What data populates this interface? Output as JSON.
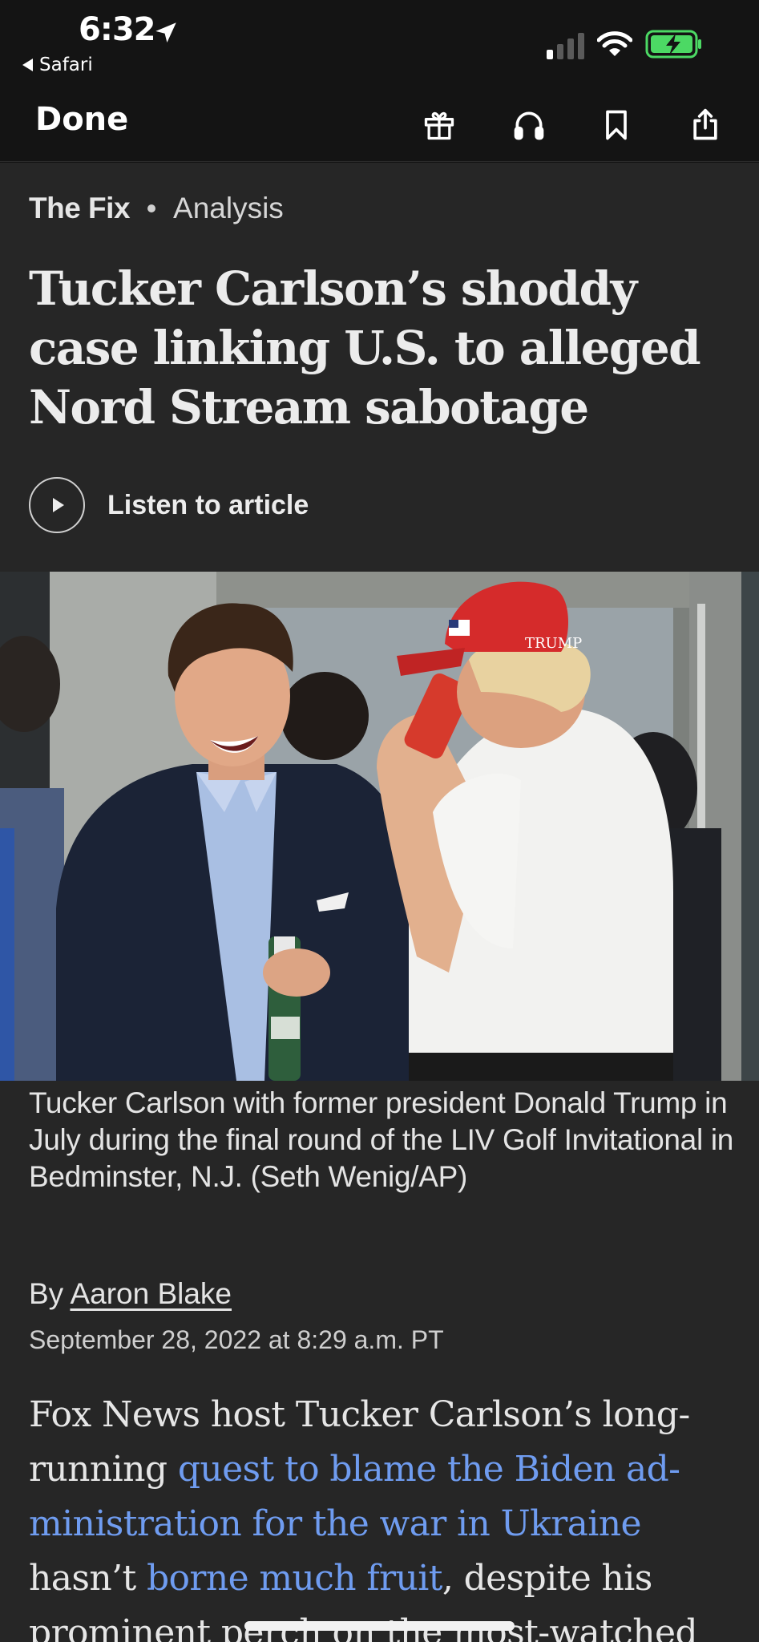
{
  "status_bar": {
    "time": "6:32",
    "back_app": "Safari",
    "icons": [
      "location-arrow-icon",
      "cellular-signal-icon",
      "wifi-icon",
      "battery-charging-icon"
    ],
    "battery_color": "#4cd964"
  },
  "toolbar": {
    "done_label": "Done",
    "icons": [
      "gift-icon",
      "headphones-icon",
      "bookmark-icon",
      "share-icon"
    ]
  },
  "article": {
    "section": "The Fix",
    "label": "Analysis",
    "headline": "Tucker Carlson’s shoddy case linking U.S. to alleged Nord Stream sabotage",
    "listen_label": "Listen to article",
    "photo_caption": "Tucker Carlson with former president Donald Trump in July during the final round of the LIV Golf Invitational in Bedminster, N.J. (Seth Wenig/AP)",
    "photo_hat_text": "TRUMP",
    "byline_prefix": "By",
    "author": "Aaron Blake",
    "date": "September 28, 2022 at 8:29 a.m. PT",
    "body": {
      "t1": "Fox News host Tucker Carlson’s long-running ",
      "link1": "quest to blame the Biden ad­ministration for the war in Ukraine",
      "t2": " hasn’t ",
      "link2": "borne much fruit",
      "t3": ", despite his prominent perch on the most-watched"
    },
    "link_color": "#6f9cf0"
  }
}
